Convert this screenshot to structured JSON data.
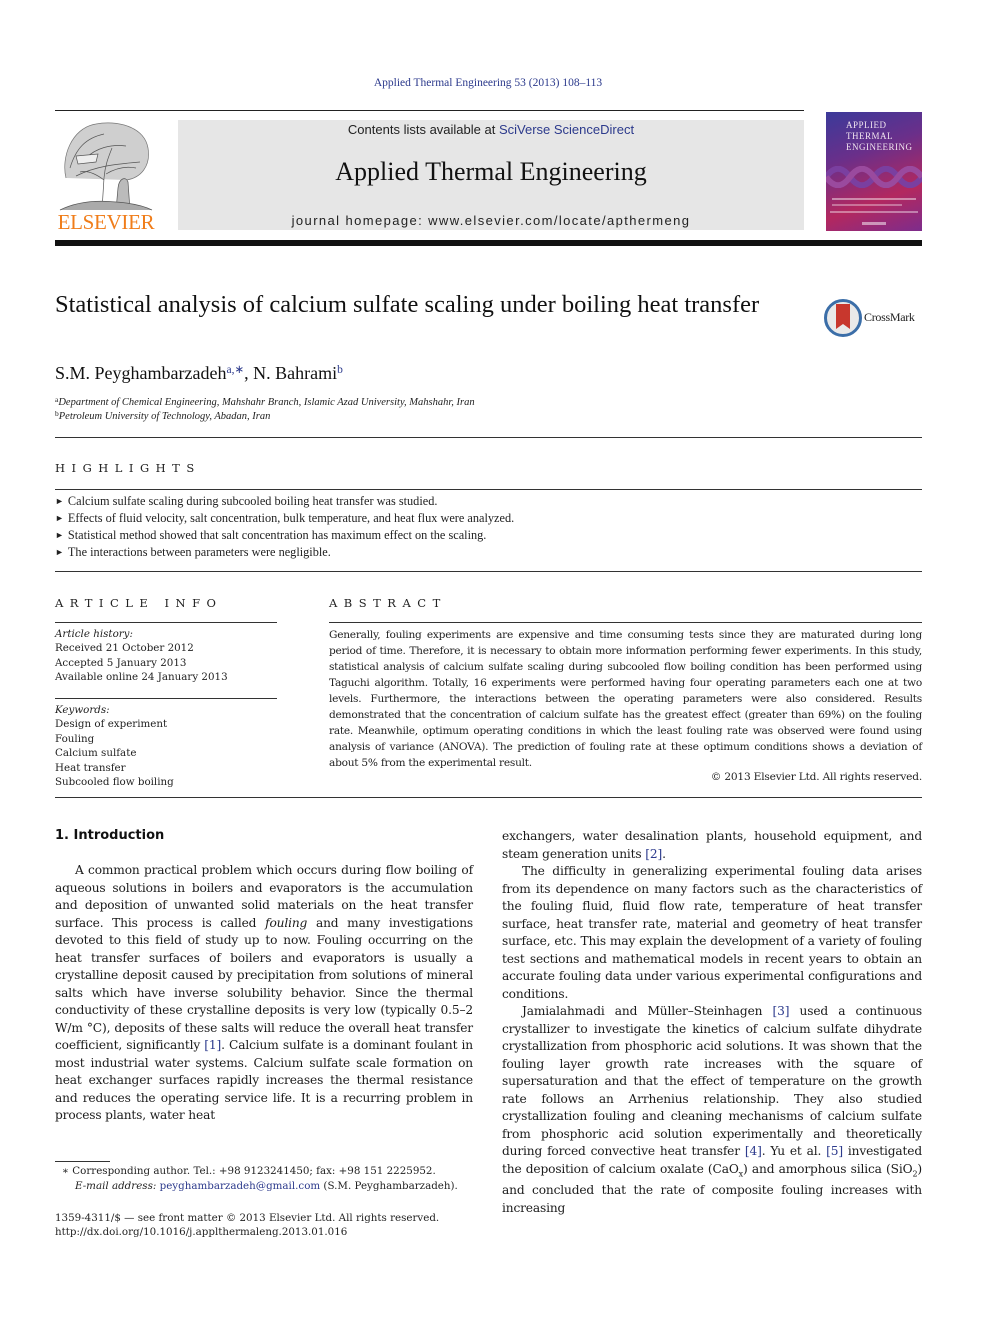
{
  "running_header": "Applied Thermal Engineering 53 (2013) 108–113",
  "masthead": {
    "publisher_logo_text": "ELSEVIER",
    "contents_prefix": "Contents lists available at ",
    "contents_link": "SciVerse ScienceDirect",
    "journal_title": "Applied Thermal Engineering",
    "homepage_label": "journal homepage: www.elsevier.com/locate/apthermeng",
    "cover_title_lines": [
      "APPLIED",
      "THERMAL",
      "ENGINEERING"
    ]
  },
  "article": {
    "title": "Statistical analysis of calcium sulfate scaling under boiling heat transfer",
    "crossmark_label": "CrossMark",
    "authors": [
      {
        "name": "S.M. Peyghambarzadeh",
        "sup": "a,∗"
      },
      {
        "name": "N. Bahrami",
        "sup": "b"
      }
    ],
    "author_separator": ", ",
    "affiliations": [
      {
        "mark": "a",
        "text": "Department of Chemical Engineering, Mahshahr Branch, Islamic Azad University, Mahshahr, Iran"
      },
      {
        "mark": "b",
        "text": "Petroleum University of Technology, Abadan, Iran"
      }
    ]
  },
  "highlights": {
    "heading": "HIGHLIGHTS",
    "bullet": "►",
    "items": [
      "Calcium sulfate scaling during subcooled boiling heat transfer was studied.",
      "Effects of fluid velocity, salt concentration, bulk temperature, and heat flux were analyzed.",
      "Statistical method showed that salt concentration has maximum effect on the scaling.",
      "The interactions between parameters were negligible."
    ]
  },
  "article_info": {
    "heading": "ARTICLE INFO",
    "history_label": "Article history:",
    "history": [
      "Received 21 October 2012",
      "Accepted 5 January 2013",
      "Available online 24 January 2013"
    ],
    "keywords_label": "Keywords:",
    "keywords": [
      "Design of experiment",
      "Fouling",
      "Calcium sulfate",
      "Heat transfer",
      "Subcooled flow boiling"
    ]
  },
  "abstract": {
    "heading": "ABSTRACT",
    "text": "Generally, fouling experiments are expensive and time consuming tests since they are maturated during long period of time. Therefore, it is necessary to obtain more information performing fewer experiments. In this study, statistical analysis of calcium sulfate scaling during subcooled flow boiling condition has been performed using Taguchi algorithm. Totally, 16 experiments were performed having four operating parameters each one at two levels. Furthermore, the interactions between the operating parameters were also considered. Results demonstrated that the concentration of calcium sulfate has the greatest effect (greater than 69%) on the fouling rate. Meanwhile, optimum operating conditions in which the least fouling rate was observed were found using analysis of variance (ANOVA). The prediction of fouling rate at these optimum conditions shows a deviation of about 5% from the experimental result.",
    "copyright": "© 2013 Elsevier Ltd. All rights reserved."
  },
  "introduction": {
    "heading": "1.  Introduction",
    "left_p1_a": "A common practical problem which occurs during flow boiling of aqueous solutions in boilers and evaporators is the accumulation and deposition of unwanted solid materials on the heat transfer surface. This process is called ",
    "left_p1_italic": "fouling",
    "left_p1_b": " and many investigations devoted to this field of study up to now. Fouling occurring on the heat transfer surfaces of boilers and evaporators is usually a crystalline deposit caused by precipitation from solutions of mineral salts which have inverse solubility behavior. Since the thermal conductivity of these crystalline deposits is very low (typically 0.5–2 W/m °C), deposits of these salts will reduce the overall heat transfer coefficient, significantly ",
    "ref1": "[1]",
    "left_p1_c": ". Calcium sulfate is a dominant foulant in most industrial water systems. Calcium sulfate scale formation on heat exchanger surfaces rapidly increases the thermal resistance and reduces the operating service life. It is a recurring problem in process plants, water heat",
    "right_p0_a": "exchangers, water desalination plants, household equipment, and steam generation units ",
    "ref2": "[2]",
    "right_p0_b": ".",
    "right_p1": "The difficulty in generalizing experimental fouling data arises from its dependence on many factors such as the characteristics of the fouling fluid, fluid flow rate, temperature of heat transfer surface, heat transfer rate, material and geometry of heat transfer surface, etc. This may explain the development of a variety of fouling test sections and mathematical models in recent years to obtain an accurate fouling data under various experimental configurations and conditions.",
    "right_p2_a": "Jamialahmadi and Müller–Steinhagen ",
    "ref3": "[3]",
    "right_p2_b": " used a continuous crystallizer to investigate the kinetics of calcium sulfate dihydrate crystallization from phosphoric acid solutions. It was shown that the fouling layer growth rate increases with the square of supersaturation and that the effect of temperature on the growth rate follows an Arrhenius relationship. They also studied crystallization fouling and cleaning mechanisms of calcium sulfate from phosphoric acid solution experimentally and theoretically during forced convective heat transfer ",
    "ref4": "[4]",
    "right_p2_c": ". Yu et al. ",
    "ref5": "[5]",
    "right_p2_d": " investigated the deposition of calcium oxalate (CaO",
    "sub_x": "x",
    "right_p2_e": ") and amorphous silica (SiO",
    "sub_2": "2",
    "right_p2_f": ") and concluded that the rate of composite fouling increases with increasing"
  },
  "footnotes": {
    "corresponding": "∗  Corresponding author. Tel.: +98 9123241450; fax: +98 151 2225952.",
    "email_label": "E-mail address: ",
    "email": "peyghambarzadeh@gmail.com",
    "email_suffix": " (S.M. Peyghambarzadeh).",
    "front_matter": "1359-4311/$ — see front matter © 2013 Elsevier Ltd. All rights reserved.",
    "doi": "http://dx.doi.org/10.1016/j.applthermaleng.2013.01.016"
  },
  "colors": {
    "link": "#2c3a8c",
    "elsevier_orange": "#f07d1a",
    "masthead_grey": "#e6e6e6",
    "crossmark_red": "#c8372d"
  }
}
